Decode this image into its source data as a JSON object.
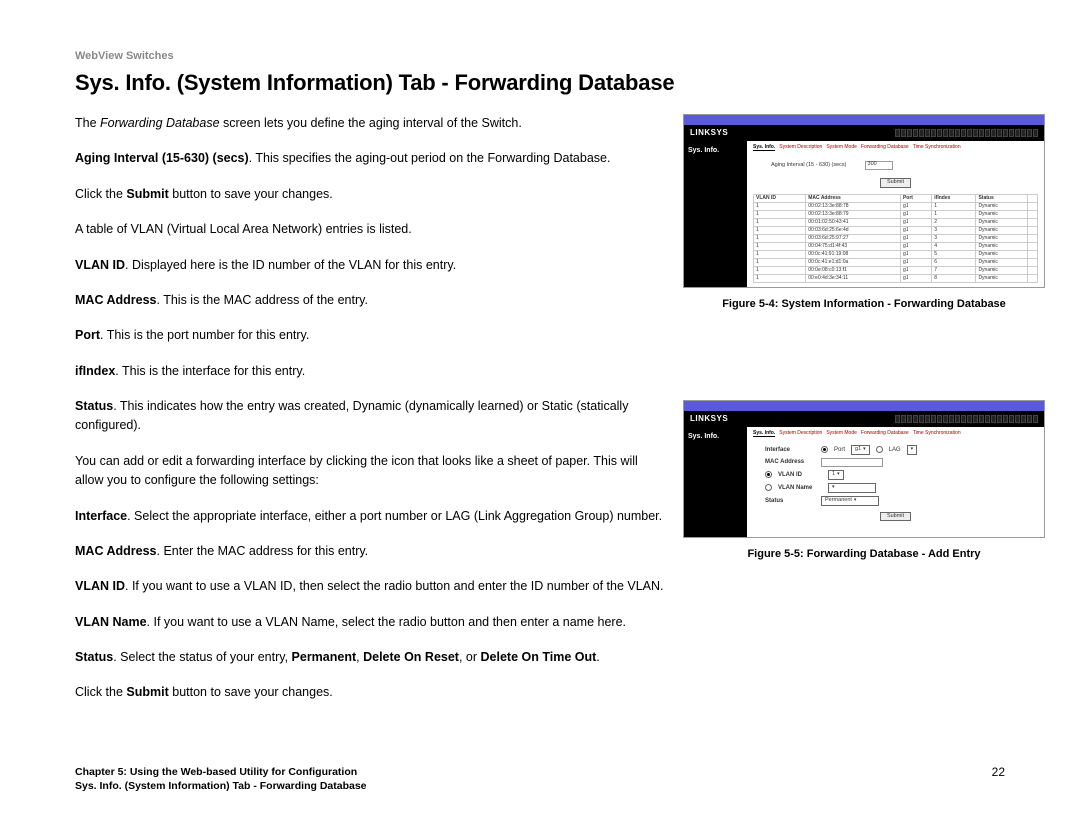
{
  "header": "WebView Switches",
  "title": "Sys. Info. (System Information) Tab - Forwarding Database",
  "para": {
    "p1a": "The ",
    "p1b": "Forwarding Database",
    "p1c": " screen lets you define the aging interval of the Switch.",
    "p2a": "Aging Interval (15-630) (secs)",
    "p2b": ". This specifies the aging-out period on the Forwarding Database.",
    "p3a": "Click the ",
    "p3b": "Submit",
    "p3c": " button to save your changes.",
    "p4": "A table of VLAN (Virtual Local Area Network) entries is listed.",
    "p5a": "VLAN ID",
    "p5b": ". Displayed here is the ID number of the VLAN for this entry.",
    "p6a": "MAC Address",
    "p6b": ". This is the MAC address of the entry.",
    "p7a": "Port",
    "p7b": ". This is the port number for this entry.",
    "p8a": "ifIndex",
    "p8b": ". This is the interface for this entry.",
    "p9a": "Status",
    "p9b": ". This indicates how the entry was created, Dynamic (dynamically learned) or Static (statically configured).",
    "p10": "You can add or edit a forwarding interface by clicking the icon that looks like a sheet of paper. This will allow you to configure the following settings:",
    "p11a": "Interface",
    "p11b": ". Select the appropriate interface, either a port number or LAG (Link Aggregation Group) number.",
    "p12a": "MAC Address",
    "p12b": ". Enter the MAC address for this entry.",
    "p13a": "VLAN ID",
    "p13b": ". If you want to use a VLAN ID, then select the radio button and enter the ID number of the VLAN.",
    "p14a": "VLAN Name",
    "p14b": ". If you want to use a VLAN Name, select the radio button and then enter a name here.",
    "p15a": "Status",
    "p15b": ". Select the status of your entry, ",
    "p15c": "Permanent",
    "p15d": ", ",
    "p15e": "Delete On Reset",
    "p15f": ", or ",
    "p15g": "Delete On Time Out",
    "p15h": ".",
    "p16a": "Click the ",
    "p16b": "Submit",
    "p16c": " button to save your changes."
  },
  "fig1": {
    "caption": "Figure 5-4: System Information - Forwarding Database",
    "logo": "LINKSYS",
    "nav": "Sys. Info.",
    "tabs": [
      "Sys. Info.",
      "System Description",
      "System Mode",
      "Forwarding Database",
      "Time Synchronization"
    ],
    "aging_label": "Aging Interval (15 - 630) (secs)",
    "aging_value": "300",
    "submit": "Submit",
    "cols": [
      "VLAN ID",
      "MAC Address",
      "Port",
      "ifIndex",
      "Status",
      ""
    ],
    "rows": [
      [
        "1",
        "00:02:13:3e:88:78",
        "g1",
        "1",
        "Dynamic",
        ""
      ],
      [
        "1",
        "00:02:13:3e:88:79",
        "g1",
        "1",
        "Dynamic",
        ""
      ],
      [
        "1",
        "00:01:02:50:43:41",
        "g1",
        "2",
        "Dynamic",
        ""
      ],
      [
        "1",
        "00:03:6d:25:6e:4d",
        "g1",
        "3",
        "Dynamic",
        ""
      ],
      [
        "1",
        "00:03:6d:25:97:27",
        "g1",
        "3",
        "Dynamic",
        ""
      ],
      [
        "1",
        "00:04:75:d1:4f:43",
        "g1",
        "4",
        "Dynamic",
        ""
      ],
      [
        "1",
        "00:0c:41:91:19:08",
        "g1",
        "5",
        "Dynamic",
        ""
      ],
      [
        "1",
        "00:0c:41:e1:d1:0a",
        "g1",
        "6",
        "Dynamic",
        ""
      ],
      [
        "1",
        "00:0e:08:c0:13:f1",
        "g1",
        "7",
        "Dynamic",
        ""
      ],
      [
        "1",
        "00:e0:4d:3e:34:11",
        "g1",
        "8",
        "Dynamic",
        ""
      ]
    ]
  },
  "fig2": {
    "caption": "Figure 5-5: Forwarding Database - Add Entry",
    "logo": "LINKSYS",
    "nav": "Sys. Info.",
    "tabs": [
      "Sys. Info.",
      "System Description",
      "System Mode",
      "Forwarding Database",
      "Time Synchronization"
    ],
    "labels": {
      "interface": "Interface",
      "mac": "MAC Address",
      "vlanid": "VLAN ID",
      "vlanname": "VLAN Name",
      "status": "Status"
    },
    "port": "Port",
    "port_val": "g1",
    "lag": "LAG",
    "vlanid_val": "1",
    "status_val": "Permanent",
    "submit": "Submit"
  },
  "footer": {
    "line1": "Chapter 5: Using the Web-based Utility for Configuration",
    "line2": "Sys. Info. (System Information) Tab - Forwarding Database",
    "page": "22"
  }
}
